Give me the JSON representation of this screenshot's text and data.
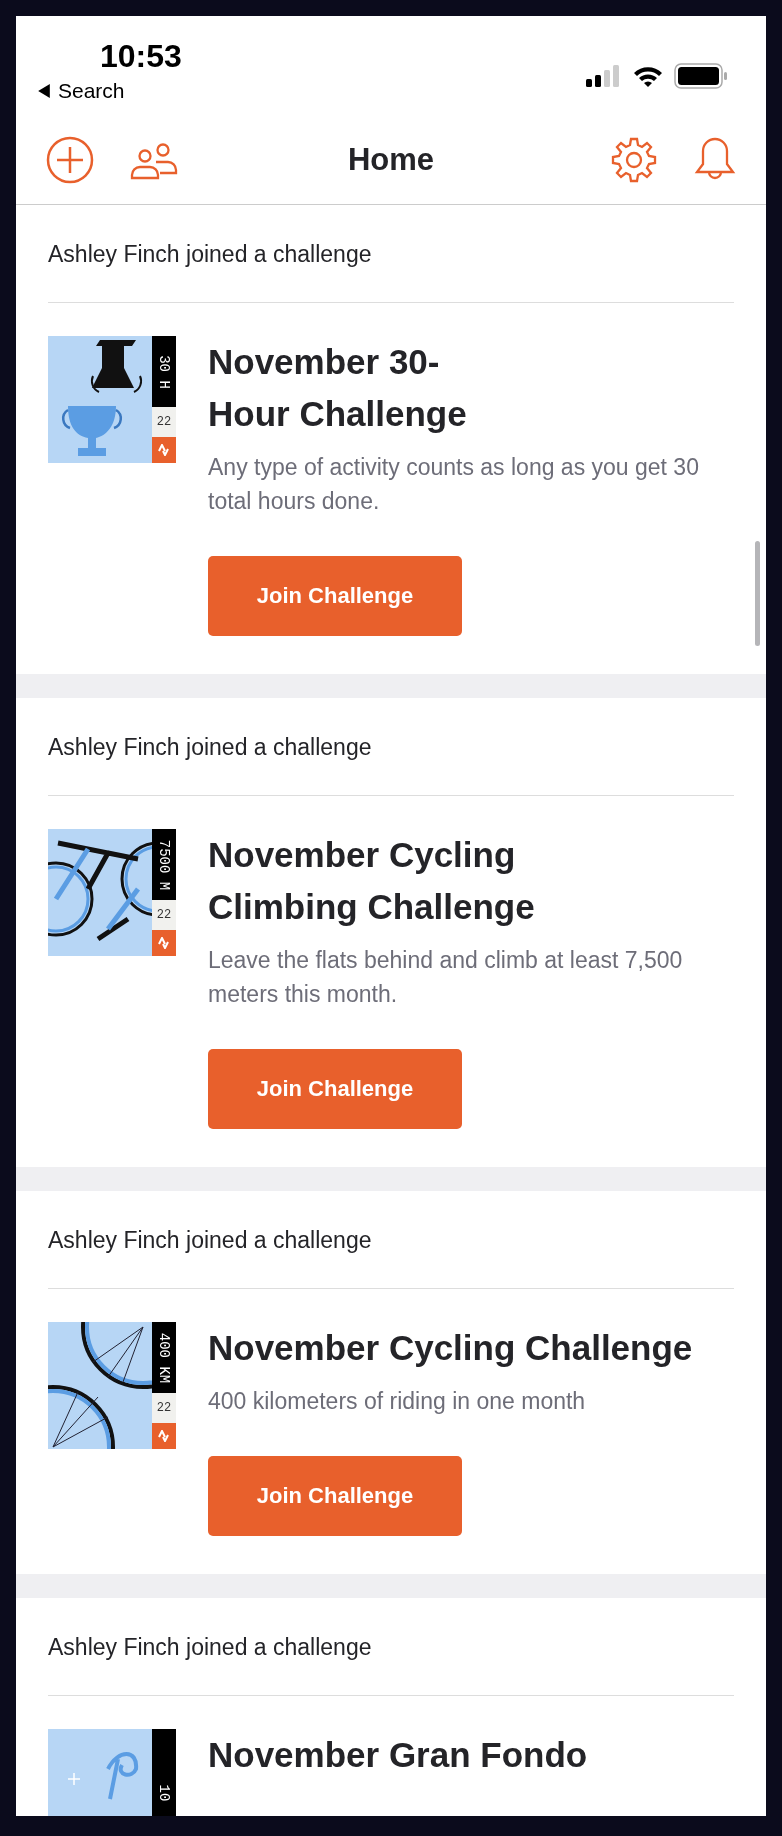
{
  "status_bar": {
    "time": "10:53",
    "back_label": "Search"
  },
  "header": {
    "title": "Home"
  },
  "feed": [
    {
      "activity": "Ashley Finch joined a challenge",
      "challenge": {
        "kind": "trophies",
        "badge_label": "30 H",
        "badge_year": "22",
        "title": "November 30-\nHour Challenge",
        "description": "Any type of activity counts as long as you get 30 total hours done.",
        "button": "Join Challenge"
      }
    },
    {
      "activity": "Ashley Finch joined a challenge",
      "challenge": {
        "kind": "bike",
        "badge_label": "7500 M",
        "badge_year": "22",
        "title": "November Cycling\nClimbing Challenge",
        "description": "Leave the flats behind and climb at least 7,500 meters this month.",
        "button": "Join Challenge"
      }
    },
    {
      "activity": "Ashley Finch joined a challenge",
      "challenge": {
        "kind": "wheels",
        "badge_label": "400 KM",
        "badge_year": "22",
        "title": "November Cycling Challenge",
        "description": "400 kilometers of riding in one month",
        "button": "Join Challenge"
      }
    },
    {
      "activity": "Ashley Finch joined a challenge",
      "challenge": {
        "kind": "fondo",
        "badge_label": "10",
        "title": "November Gran Fondo"
      }
    }
  ]
}
